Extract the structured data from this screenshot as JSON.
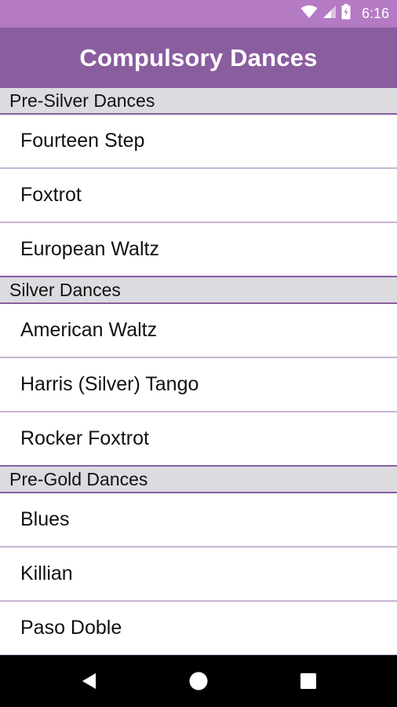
{
  "status_bar": {
    "time": "6:16",
    "icons": [
      "wifi-icon",
      "cellular-signal-icon",
      "battery-charging-icon"
    ]
  },
  "app_bar": {
    "title": "Compulsory Dances"
  },
  "sections": [
    {
      "header": "Pre-Silver Dances",
      "items": [
        "Fourteen Step",
        "Foxtrot",
        "European Waltz"
      ]
    },
    {
      "header": "Silver Dances",
      "items": [
        "American Waltz",
        "Harris (Silver) Tango",
        "Rocker Foxtrot"
      ]
    },
    {
      "header": "Pre-Gold Dances",
      "items": [
        "Blues",
        "Killian",
        "Paso Doble"
      ]
    }
  ],
  "nav_bar": {
    "buttons": [
      "back-icon",
      "home-icon",
      "recents-icon"
    ]
  },
  "colors": {
    "status_bar": "#b47ac4",
    "app_bar": "#8a5d9f",
    "section_header_bg": "#dcdbe0",
    "divider": "#c8b5d2"
  }
}
